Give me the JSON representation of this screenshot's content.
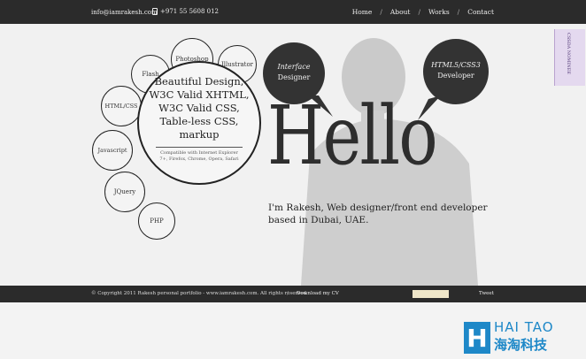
{
  "header": {
    "email": "info@iamrakesh.com",
    "phone": "+971 55 5608 012",
    "nav": [
      "Home",
      "About",
      "Works",
      "Contact"
    ]
  },
  "skills": [
    "Photoshop",
    "Flash",
    "Illustrator",
    "HTML/CSS",
    "Javascript",
    "JQuery",
    "PHP"
  ],
  "center": {
    "headline": "Beautiful Design, W3C Valid XHTML, W3C Valid CSS, Table-less CSS, markup",
    "compat": "Compatible with Internet Explorer 7+, Firefox, Chrome, Opera, Safari"
  },
  "bubbles": {
    "left_line1": "Interface",
    "left_line2": "Designer",
    "right_line1": "HTML5/CSS3",
    "right_line2": "Developer"
  },
  "hero": {
    "word": "Hello",
    "intro": "I'm Rakesh, Web designer/front end developer based in Dubai, UAE."
  },
  "ribbon": {
    "label": "CSSDA NOMINEE"
  },
  "footer": {
    "copyright": "© Copyright 2011 Rakesh personal portfolio - www.iamrakesh.com. All rights reserved.",
    "separator": "/",
    "download": "Download my CV",
    "tweet": "Tweet"
  },
  "brand": {
    "letter": "H",
    "en": "HAI TAO",
    "cn": "海淘科技"
  },
  "colors": {
    "dark": "#2b2b2b",
    "brand_blue": "#1e88c8"
  }
}
